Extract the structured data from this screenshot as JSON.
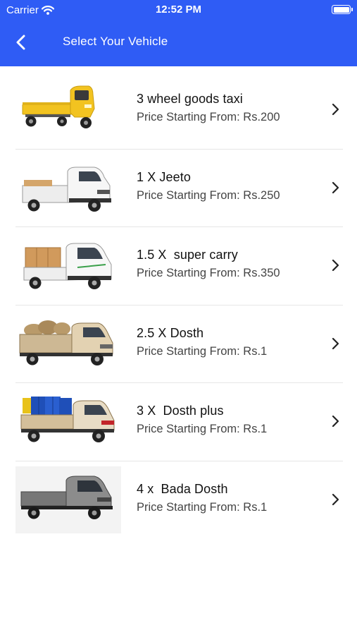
{
  "status_bar": {
    "carrier": "Carrier",
    "time": "12:52 PM"
  },
  "header": {
    "title": "Select Your Vehicle",
    "accent": "#2f5cf5"
  },
  "vehicles": [
    {
      "name": "3 wheel goods taxi",
      "price": "Price Starting From: Rs.200",
      "icon": "three-wheeler-icon",
      "color": "#f2c320"
    },
    {
      "name": "1 X Jeeto",
      "price": "Price Starting From: Rs.250",
      "icon": "mini-truck-icon",
      "color": "#f4f4f4"
    },
    {
      "name": "1.5 X  super carry",
      "price": "Price Starting From: Rs.350",
      "icon": "mini-truck-icon",
      "color": "#f4f4f4"
    },
    {
      "name": "2.5 X Dosth",
      "price": "Price Starting From: Rs.1",
      "icon": "pickup-truck-icon",
      "color": "#e6d6b8"
    },
    {
      "name": "3 X  Dosth plus",
      "price": "Price Starting From: Rs.1",
      "icon": "pickup-truck-icon",
      "color": "#e9dcc5"
    },
    {
      "name": "4 x  Bada Dosth",
      "price": "Price Starting From: Rs.1",
      "icon": "pickup-truck-icon",
      "color": "#8c8c8c"
    }
  ]
}
